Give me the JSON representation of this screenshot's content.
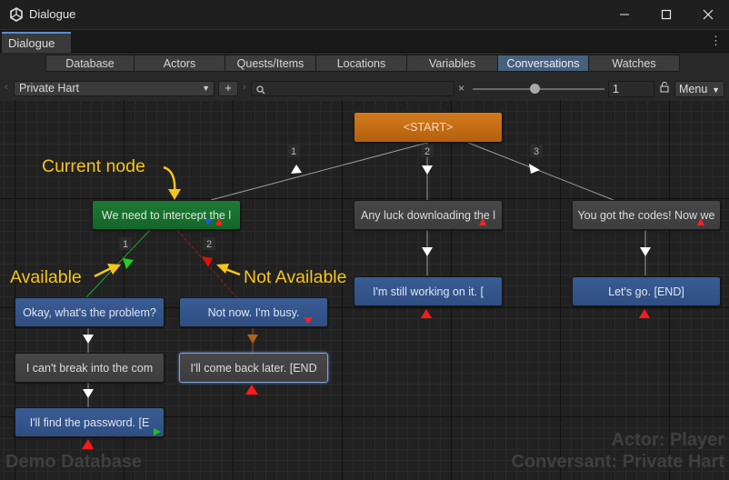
{
  "window": {
    "title": "Dialogue",
    "minimize_icon": "minimize-icon",
    "maximize_icon": "maximize-icon",
    "close_icon": "close-icon"
  },
  "editor_tab": {
    "label": "Dialogue",
    "accent_color": "#5c8dcc"
  },
  "toolbar": {
    "tabs": [
      {
        "label": "Database",
        "active": false
      },
      {
        "label": "Actors",
        "active": false
      },
      {
        "label": "Quests/Items",
        "active": false
      },
      {
        "label": "Locations",
        "active": false
      },
      {
        "label": "Variables",
        "active": false
      },
      {
        "label": "Conversations",
        "active": true
      },
      {
        "label": "Watches",
        "active": false
      }
    ],
    "active_tab_color": "#46607e",
    "conversation_select": "Private Hart",
    "add_label": "+",
    "search_value": "",
    "clear_label": "×",
    "zoom_value": "1",
    "zoom_slider_fraction": 0.47,
    "menu_label": "Menu"
  },
  "graph": {
    "link_labels": [
      "1",
      "2",
      "3",
      "1",
      "2"
    ],
    "nodes": {
      "start": "<START>",
      "current": "We need to intercept the l",
      "any_luck": "Any luck downloading the l",
      "got_codes": "You got the codes! Now we",
      "still_working": "I'm still working on it. [",
      "lets_go": "Let's go. [END]",
      "okay_problem": "Okay, what's the problem?",
      "not_now": "Not now. I'm busy.",
      "cant_break": "I can't break into the com",
      "come_back": "I'll come back later. [END",
      "find_password": "I'll find the password. [E"
    },
    "colors": {
      "start": "#c76d15",
      "npc_current": "#1b7431",
      "npc": "#424242",
      "player": "#345791",
      "available_link": "#1fa51f",
      "unavailable_link": "#a01c1c",
      "annotation": "#f5c518"
    }
  },
  "annotations": {
    "current_node": "Current node",
    "available": "Available",
    "not_available": "Not Available"
  },
  "watermark": {
    "database": "Demo Database",
    "actor": "Actor: Player",
    "conversant": "Conversant: Private Hart"
  }
}
